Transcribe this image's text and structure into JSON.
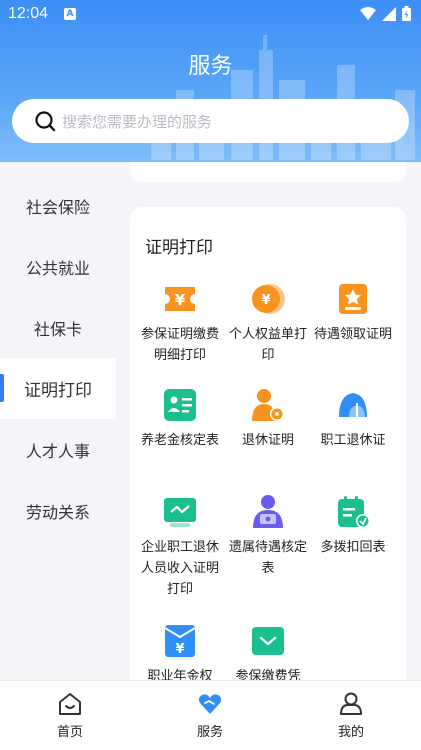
{
  "status": {
    "time": "12:04",
    "indicator": "A"
  },
  "header": {
    "title": "服务"
  },
  "search": {
    "placeholder": "搜索您需要办理的服务"
  },
  "sidebar": {
    "items": [
      {
        "label": "社会保险"
      },
      {
        "label": "公共就业"
      },
      {
        "label": "社保卡"
      },
      {
        "label": "证明打印",
        "active": true
      },
      {
        "label": "人才人事"
      },
      {
        "label": "劳动关系"
      }
    ]
  },
  "section": {
    "title": "证明打印",
    "services": [
      {
        "label": "参保证明缴费明细打印",
        "icon": "yuan-ticket-icon",
        "color": "#f7931e"
      },
      {
        "label": "个人权益单打印",
        "icon": "yuan-coin-icon",
        "color": "#f7931e"
      },
      {
        "label": "待遇领取证明",
        "icon": "star-badge-icon",
        "color": "#f7931e"
      },
      {
        "label": "养老金核定表",
        "icon": "pension-card-icon",
        "color": "#1bbf8f"
      },
      {
        "label": "退休证明",
        "icon": "retiree-person-icon",
        "color": "#f7931e"
      },
      {
        "label": "职工退休证",
        "icon": "retirement-umbrella-icon",
        "color": "#2f8ff6"
      },
      {
        "label": "企业职工退休人员收入证明打印",
        "icon": "income-monitor-icon",
        "color": "#1bbf8f"
      },
      {
        "label": "遗属待遇核定表",
        "icon": "survivor-person-icon",
        "color": "#6a5cf0"
      },
      {
        "label": "多拨扣回表",
        "icon": "calendar-form-icon",
        "color": "#1bbf8f"
      },
      {
        "label": "职业年金权",
        "icon": "annuity-envelope-icon",
        "color": "#2f8ff6"
      },
      {
        "label": "参保缴费凭",
        "icon": "payment-box-icon",
        "color": "#1bbf8f"
      }
    ]
  },
  "bottomnav": {
    "items": [
      {
        "label": "首页",
        "icon": "home-icon"
      },
      {
        "label": "服务",
        "icon": "service-heart-icon",
        "active": true
      },
      {
        "label": "我的",
        "icon": "profile-icon"
      }
    ]
  },
  "colors": {
    "accent": "#2f7cf6",
    "header_start": "#3d8ef5",
    "header_end": "#7fbdf9"
  }
}
